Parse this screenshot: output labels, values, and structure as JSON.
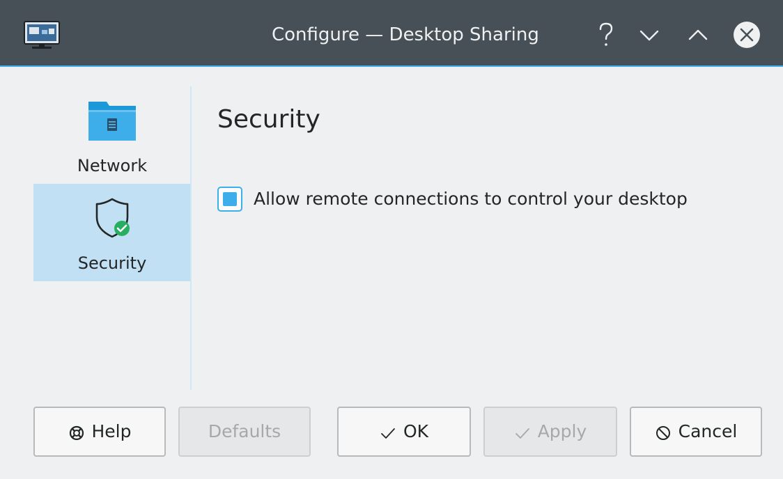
{
  "window": {
    "title": "Configure — Desktop Sharing",
    "controls": {
      "help_symbol": "?",
      "minimize_icon": "chevron-down-icon",
      "maximize_icon": "chevron-up-icon",
      "close_icon": "close-icon"
    }
  },
  "sidebar": {
    "items": [
      {
        "label": "Network",
        "icon": "folder-network-icon",
        "selected": false
      },
      {
        "label": "Security",
        "icon": "shield-check-icon",
        "selected": true
      }
    ]
  },
  "main": {
    "title": "Security",
    "options": [
      {
        "label": "Allow remote connections to control your desktop",
        "checked": true
      }
    ]
  },
  "buttons": {
    "help": "Help",
    "defaults": "Defaults",
    "ok": "OK",
    "apply": "Apply",
    "cancel": "Cancel"
  },
  "colors": {
    "titlebar": "#475057",
    "accent": "#3daee9",
    "selection": "#c1e0f3",
    "background": "#eff0f1"
  }
}
